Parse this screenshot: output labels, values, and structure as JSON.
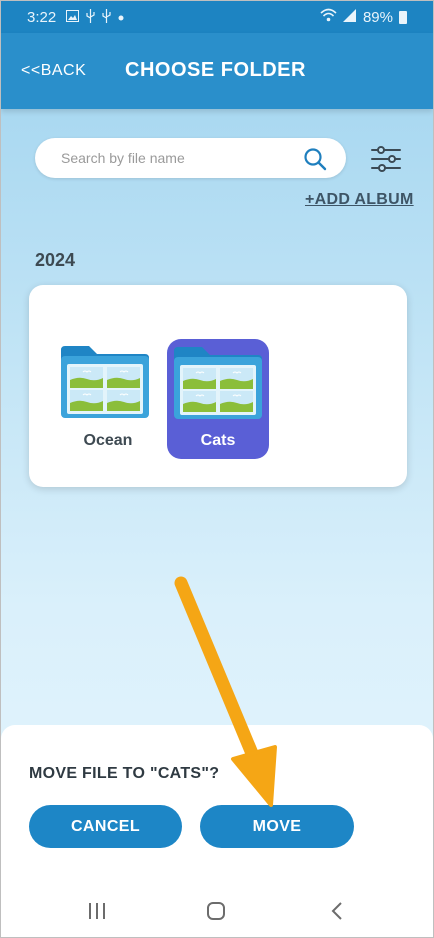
{
  "status_bar": {
    "time": "3:22",
    "battery": "89%",
    "left_icons": [
      "image-icon",
      "usb-icon",
      "usb-icon",
      "dot-icon"
    ],
    "right_icons": [
      "wifi-icon",
      "signal-icon",
      "battery-icon"
    ]
  },
  "header": {
    "back_label": "<<BACK",
    "title": "CHOOSE FOLDER",
    "color": "#2a8fcb"
  },
  "search": {
    "placeholder": "Search by file name",
    "value": ""
  },
  "toolbar": {
    "add_album_label": "+ADD ALBUM"
  },
  "albums": {
    "year": "2024",
    "folders": [
      {
        "label": "Ocean",
        "selected": false
      },
      {
        "label": "Cats",
        "selected": true
      }
    ],
    "selected_color": "#5a5fd6"
  },
  "dialog": {
    "prompt": "MOVE FILE TO \"CATS\"?",
    "cancel_label": "CANCEL",
    "move_label": "MOVE",
    "button_color": "#1d86c6"
  },
  "annotation": {
    "arrow_color": "#f5a615"
  },
  "nav": {
    "icons": [
      "recent-apps-icon",
      "home-icon",
      "back-icon"
    ]
  }
}
